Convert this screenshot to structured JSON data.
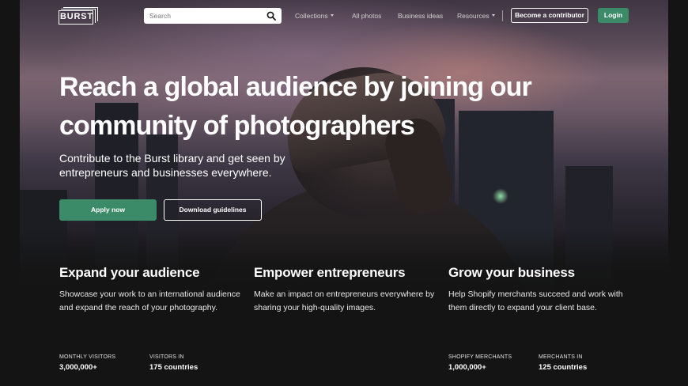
{
  "brand": {
    "logo_text": "BURST"
  },
  "search": {
    "placeholder": "Search"
  },
  "nav": {
    "collections": "Collections",
    "all_photos": "All photos",
    "business_ideas": "Business ideas",
    "resources": "Resources",
    "become_contributor": "Become a contributor",
    "login": "Login"
  },
  "hero": {
    "title": "Reach a global audience by joining our community of photographers",
    "subtitle": "Contribute to the Burst library and get seen by entrepreneurs and businesses everywhere.",
    "apply_button": "Apply now",
    "guidelines_button": "Download guidelines"
  },
  "features": [
    {
      "title": "Expand your audience",
      "text": "Showcase your work to an international audience and expand the reach of your photography.",
      "stats": [
        {
          "label": "MONTHLY VISITORS",
          "value": "3,000,000+"
        },
        {
          "label": "VISITORS IN",
          "value": "175 countries"
        }
      ]
    },
    {
      "title": "Empower entrepreneurs",
      "text": "Make an impact on entrepreneurs everywhere by sharing your high-quality images."
    },
    {
      "title": "Grow your business",
      "text": "Help Shopify merchants succeed and work with them directly to expand your client base.",
      "stats": [
        {
          "label": "SHOPIFY MERCHANTS",
          "value": "1,000,000+"
        },
        {
          "label": "MERCHANTS IN",
          "value": "125 countries"
        }
      ]
    }
  ],
  "colors": {
    "accent_green": "#3b8a68",
    "background": "#141414",
    "text": "#ffffff"
  }
}
